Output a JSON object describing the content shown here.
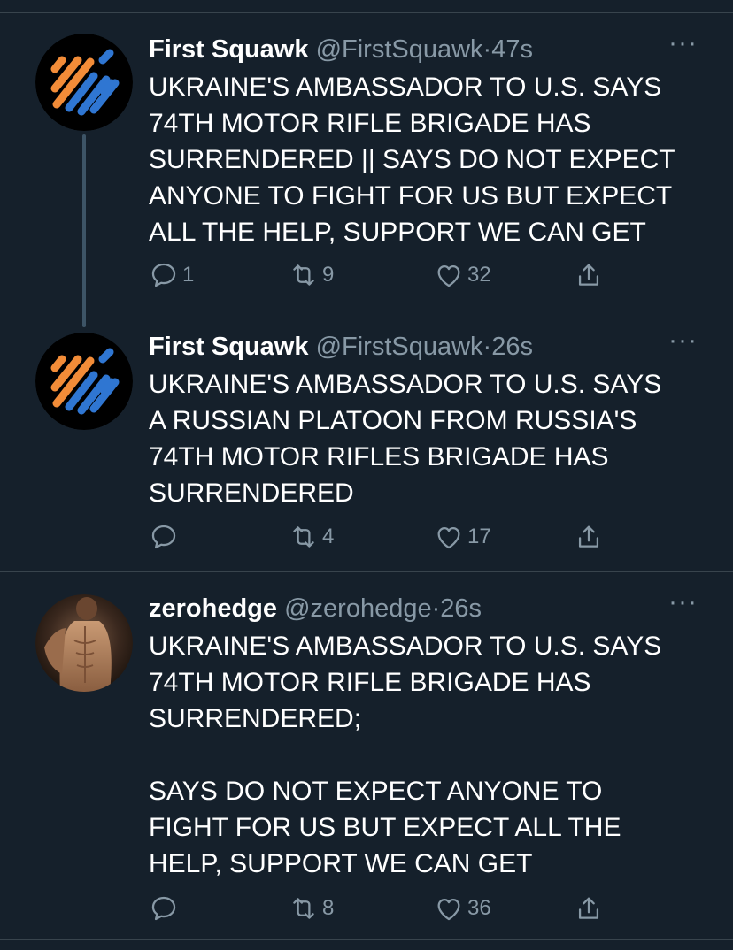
{
  "tweets": [
    {
      "name": "First Squawk",
      "handle": "@FirstSquawk",
      "separator": "·",
      "time": "47s",
      "text": "UKRAINE'S AMBASSADOR TO U.S. SAYS\n74TH MOTOR RIFLE BRIGADE HAS\nSURRENDERED ||  SAYS DO NOT EXPECT\nANYONE TO FIGHT FOR US BUT EXPECT\nALL THE HELP, SUPPORT WE CAN GET",
      "replies": "1",
      "retweets": "9",
      "likes": "32",
      "more": "···"
    },
    {
      "name": "First Squawk",
      "handle": "@FirstSquawk",
      "separator": "·",
      "time": "26s",
      "text": "UKRAINE'S AMBASSADOR TO U.S. SAYS\nA RUSSIAN PLATOON FROM RUSSIA'S\n74TH MOTOR RIFLES BRIGADE HAS\nSURRENDERED",
      "replies": "",
      "retweets": "4",
      "likes": "17",
      "more": "···"
    },
    {
      "name": "zerohedge",
      "handle": "@zerohedge",
      "separator": "·",
      "time": "26s",
      "text": "UKRAINE'S AMBASSADOR TO U.S. SAYS\n74TH MOTOR RIFLE BRIGADE HAS\nSURRENDERED;\n\nSAYS DO NOT EXPECT ANYONE TO\nFIGHT FOR US BUT EXPECT ALL THE\nHELP, SUPPORT WE CAN GET",
      "replies": "",
      "retweets": "8",
      "likes": "36",
      "more": "···"
    }
  ],
  "icons": {
    "reply": "reply-icon",
    "retweet": "retweet-icon",
    "like": "heart-icon",
    "share": "share-icon",
    "more": "more-options-icon"
  },
  "colors": {
    "background": "#15202b",
    "secondary_text": "#8899a6",
    "divider": "#38444d",
    "first_squawk_orange": "#f28c38",
    "first_squawk_blue": "#2f76d2"
  }
}
